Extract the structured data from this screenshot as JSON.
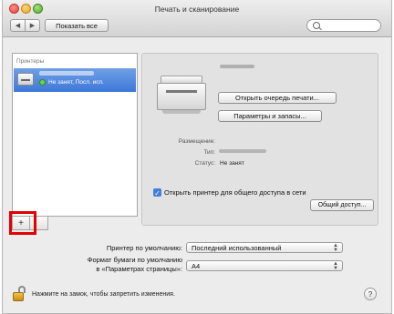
{
  "window": {
    "title": "Печать и сканирование"
  },
  "toolbar": {
    "back_icon": "◀",
    "forward_icon": "▶",
    "show_all_label": "Показать все",
    "search_placeholder": ""
  },
  "printer_list": {
    "header": "Принтеры",
    "selected_item": {
      "status": "Не занят, Посл. исп."
    },
    "add_label": "+",
    "remove_label": ""
  },
  "details": {
    "open_queue_label": "Открыть очередь печати...",
    "options_label": "Параметры и запасы...",
    "location_label": "Размещение:",
    "type_label": "Тип:",
    "status_label": "Статус:",
    "status_value": "Не занят",
    "share_label": "Открыть принтер для общего доступа в сети",
    "share_checked": true,
    "sharing_button_label": "Общий доступ..."
  },
  "defaults": {
    "default_printer_label": "Принтер по умолчанию:",
    "default_printer_value": "Последний использованный",
    "paper_size_label_line1": "Формат бумаги по умолчанию",
    "paper_size_label_line2": "в «Параметрах страницы»:",
    "paper_size_value": "A4"
  },
  "footer": {
    "lock_text": "Нажмите на замок, чтобы запретить изменения.",
    "help_label": "?"
  },
  "colors": {
    "highlight": "#e30000",
    "selection": "#3e77d8"
  }
}
